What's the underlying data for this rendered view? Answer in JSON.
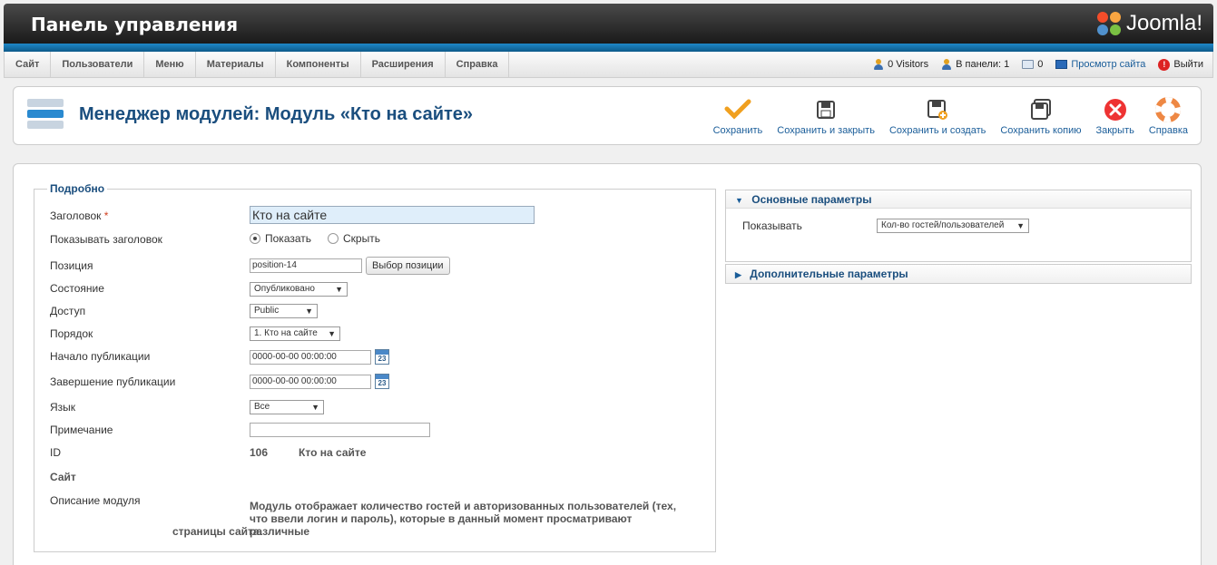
{
  "header": {
    "title": "Панель управления",
    "logo_text": "Joomla!"
  },
  "menu": [
    "Сайт",
    "Пользователи",
    "Меню",
    "Материалы",
    "Компоненты",
    "Расширения",
    "Справка"
  ],
  "status": {
    "visitors": "0 Visitors",
    "in_panel": "В панели: 1",
    "messages": "0",
    "view_site": "Просмотр сайта",
    "logout": "Выйти"
  },
  "page": {
    "title": "Менеджер модулей: Модуль «Кто на сайте»"
  },
  "toolbar": {
    "save": "Сохранить",
    "save_close": "Сохранить и закрыть",
    "save_new": "Сохранить и создать",
    "save_copy": "Сохранить копию",
    "close": "Закрыть",
    "help": "Справка"
  },
  "details": {
    "legend": "Подробно",
    "title_label": "Заголовок",
    "title_required": "*",
    "title_value": "Кто на сайте",
    "show_title_label": "Показывать заголовок",
    "show_title_options": [
      "Показать",
      "Скрыть"
    ],
    "position_label": "Позиция",
    "position_value": "position-14",
    "position_button": "Выбор позиции",
    "state_label": "Состояние",
    "state_value": "Опубликовано",
    "access_label": "Доступ",
    "access_value": "Public",
    "order_label": "Порядок",
    "order_value": "1. Кто на сайте",
    "publish_up_label": "Начало публикации",
    "publish_up_value": "0000-00-00 00:00:00",
    "publish_down_label": "Завершение публикации",
    "publish_down_value": "0000-00-00 00:00:00",
    "calendar_day": "23",
    "language_label": "Язык",
    "language_value": "Все",
    "note_label": "Примечание",
    "note_value": "",
    "id_label": "ID",
    "id_value": "106",
    "id_name": "Кто на сайте",
    "site_label": "Сайт",
    "description_label": "Описание модуля",
    "description_line1": "Модуль отображает количество гостей и авторизованных пользователей (тех, что ввели логин и пароль), которые в данный момент просматривают различные",
    "description_line2": "страницы сайта."
  },
  "basic_params": {
    "title": "Основные параметры",
    "show_label": "Показывать",
    "show_value": "Кол-во гостей/пользователей"
  },
  "advanced_params": {
    "title": "Дополнительные параметры"
  }
}
